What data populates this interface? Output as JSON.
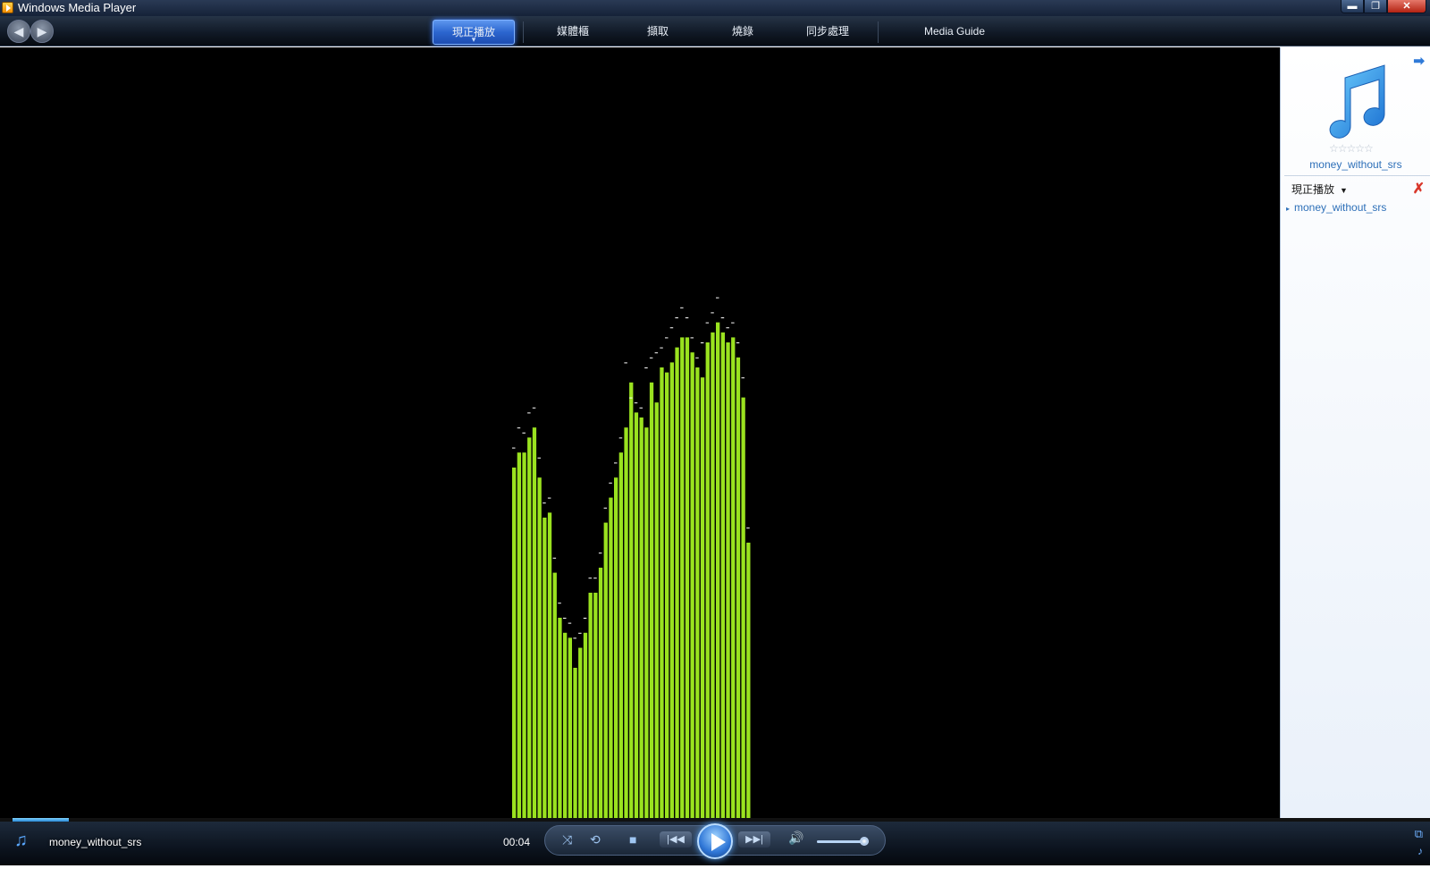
{
  "window": {
    "title": "Windows Media Player",
    "buttons": {
      "minimize": "▬",
      "restore": "❐",
      "close": "✕"
    }
  },
  "nav": {
    "back_glyph": "◀",
    "forward_glyph": "▶",
    "tabs": [
      {
        "label": "現正播放",
        "active": true
      },
      {
        "label": "媒體櫃",
        "active": false
      },
      {
        "label": "擷取",
        "active": false
      },
      {
        "label": "燒錄",
        "active": false
      },
      {
        "label": "同步處理",
        "active": false
      },
      {
        "label": "Media Guide",
        "active": false
      }
    ]
  },
  "visualization": {
    "bar_color": "#9ae21f",
    "peak_color": "#ffffff",
    "levels": [
      0.7,
      0.73,
      0.73,
      0.76,
      0.78,
      0.68,
      0.6,
      0.61,
      0.49,
      0.4,
      0.37,
      0.36,
      0.3,
      0.34,
      0.37,
      0.45,
      0.45,
      0.5,
      0.59,
      0.64,
      0.68,
      0.73,
      0.78,
      0.87,
      0.81,
      0.8,
      0.78,
      0.87,
      0.83,
      0.9,
      0.89,
      0.91,
      0.94,
      0.96,
      0.96,
      0.93,
      0.9,
      0.88,
      0.95,
      0.97,
      0.99,
      0.97,
      0.95,
      0.96,
      0.92,
      0.84,
      0.55
    ],
    "peaks": [
      0.74,
      0.78,
      0.77,
      0.81,
      0.82,
      0.72,
      0.63,
      0.64,
      0.52,
      0.43,
      0.4,
      0.39,
      0.36,
      0.37,
      0.4,
      0.48,
      0.48,
      0.53,
      0.62,
      0.67,
      0.71,
      0.76,
      0.91,
      0.84,
      0.83,
      0.82,
      0.9,
      0.92,
      0.93,
      0.94,
      0.96,
      0.98,
      1.0,
      1.02,
      1.0,
      0.96,
      0.92,
      0.95,
      0.99,
      1.01,
      1.04,
      1.0,
      0.98,
      0.99,
      0.95,
      0.88,
      0.58
    ]
  },
  "right_pane": {
    "nav_arrow": "➡",
    "stars": "☆☆☆☆☆",
    "now_playing_title": "money_without_srs",
    "list_header": "現正播放",
    "list_header_caret": "▼",
    "clear_glyph": "✗",
    "list_items": [
      "money_without_srs"
    ]
  },
  "transport": {
    "track_name": "money_without_srs",
    "elapsed": "00:04",
    "seek_progress": 0.04,
    "volume": 0.92,
    "shuffle_glyph": "⤨",
    "repeat_glyph": "⟲",
    "stop_glyph": "■",
    "prev_glyph": "|◀◀",
    "next_glyph": "▶▶|",
    "mute_glyph": "🔊",
    "note_glyph": "♫",
    "corner_top_glyph": "⧉",
    "corner_bottom_glyph": "♪"
  }
}
